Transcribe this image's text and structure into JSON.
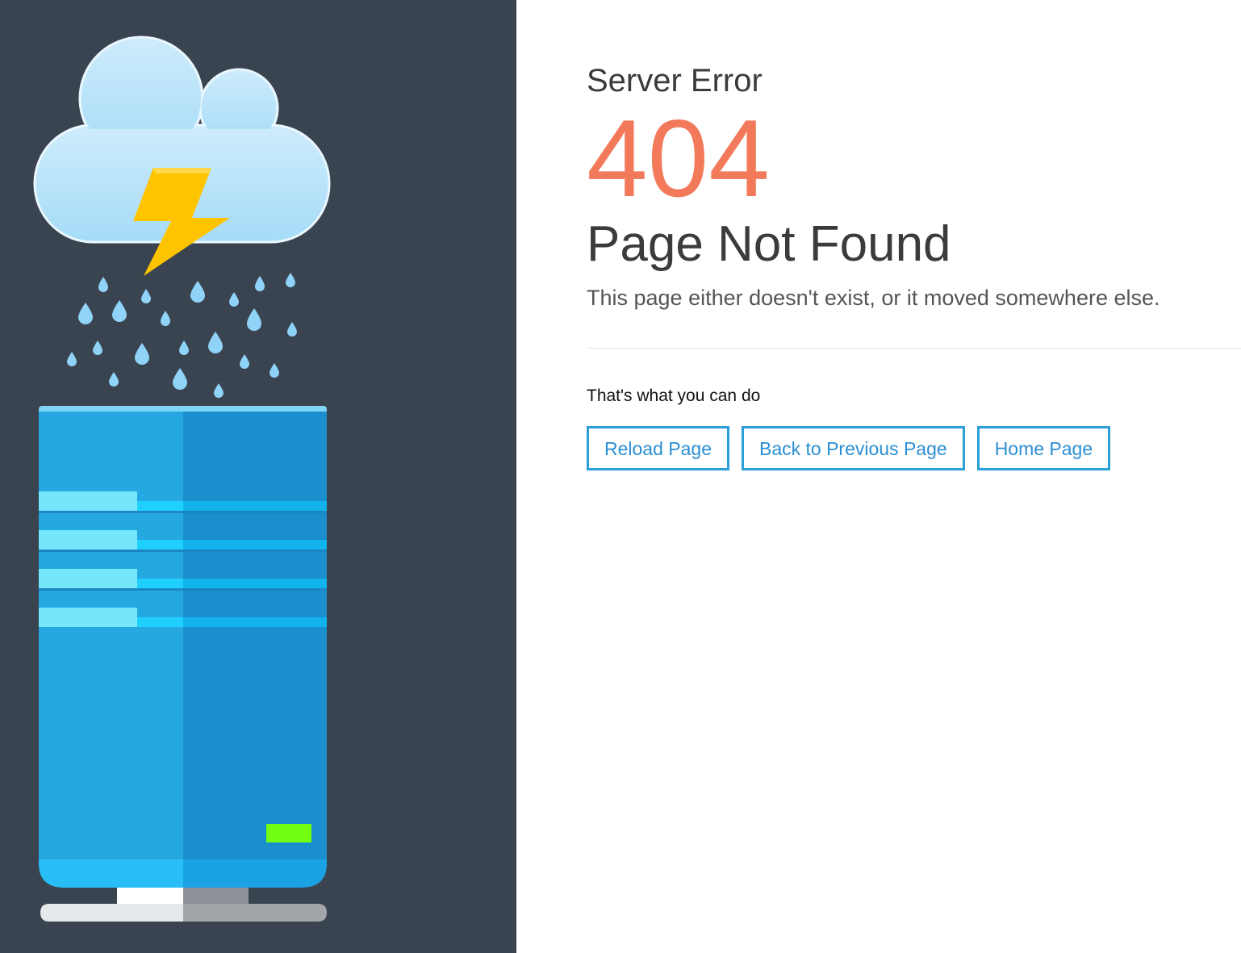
{
  "header": {
    "subtitle": "Server Error",
    "code": "404",
    "title": "Page Not Found",
    "description": "This page either doesn't exist, or it moved somewhere else."
  },
  "actions": {
    "label": "That's what you can do",
    "buttons": [
      {
        "label": "Reload Page"
      },
      {
        "label": "Back to Previous Page"
      },
      {
        "label": "Home Page"
      }
    ]
  },
  "colors": {
    "left_panel_bg": "#3a4450",
    "error_code": "#f27a5a",
    "button_border": "#2a9fd8",
    "button_text": "#2a8fd4"
  },
  "icons": [
    "cloud-icon",
    "lightning-bolt-icon",
    "rain-drop-icon",
    "server-icon"
  ]
}
